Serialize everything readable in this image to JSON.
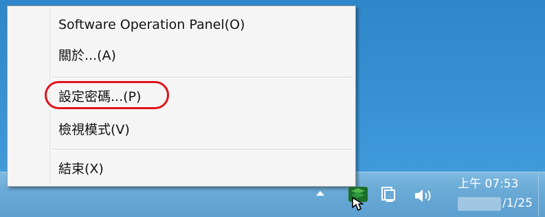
{
  "context_menu": {
    "items": [
      {
        "label": "Software Operation Panel(O)"
      },
      {
        "label": "關於...(A)"
      },
      {
        "label": "設定密碼...(P)"
      },
      {
        "label": "檢視模式(V)"
      },
      {
        "label": "結束(X)"
      }
    ],
    "highlighted_item": "設定密碼...(P)",
    "highlight_color": "#e0121b"
  },
  "taskbar": {
    "clock": {
      "time": "上午 07:53",
      "date": "/1/25"
    },
    "tray_icons": [
      "show-hidden-icons-arrow",
      "scanner-tray-icon",
      "network-icon",
      "volume-icon"
    ]
  }
}
